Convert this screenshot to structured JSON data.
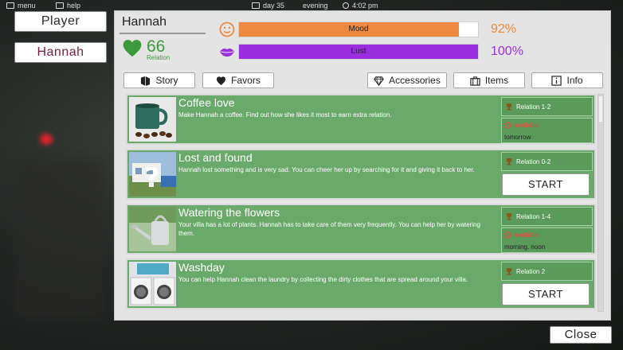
{
  "topbar": {
    "menu": "menu",
    "help": "help",
    "day": "day 35",
    "time_of_day": "evening",
    "clock": "4:02 pm"
  },
  "sidebar": {
    "player": "Player",
    "hannah": "Hannah"
  },
  "character": {
    "name": "Hannah",
    "relation_value": "66",
    "relation_label": "Relation"
  },
  "stats": {
    "mood": {
      "label": "Mood",
      "value_text": "92%",
      "fraction": 0.92,
      "color": "#ee8a3f"
    },
    "lust": {
      "label": "Lust",
      "value_text": "100%",
      "fraction": 1.0,
      "color": "#9b2fe0"
    }
  },
  "tabs": {
    "story": "Story",
    "favors": "Favors",
    "accessories": "Accessories",
    "items": "Items",
    "info": "Info"
  },
  "quests": [
    {
      "title": "Coffee love",
      "description": "Make Hannah a coffee. Find out how she likes it most to earn extra relation.",
      "requirement": "Relation 1-2",
      "available_label": "available:",
      "available_when": "tomorrow",
      "image": "coffee-cup-image"
    },
    {
      "title": "Lost and found",
      "description": "Hannah lost something and is very sad. You can cheer her up by searching for it and giving it back to her.",
      "requirement": "Relation 0-2",
      "button": "START",
      "image": "question-mark-house-image"
    },
    {
      "title": "Watering the flowers",
      "description": "Your villa has a lot of plants. Hannah has to take care of them very frequently. You can help her by watering them.",
      "requirement": "Relation 1-4",
      "available_label": "available:",
      "available_when": "morning, noon",
      "image": "watering-can-image"
    },
    {
      "title": "Washday",
      "description": "You can help Hannah clean the laundry by collecting the dirty clothes that are spread around your villa.",
      "requirement": "Relation 2",
      "button": "START",
      "image": "washing-machine-image"
    }
  ],
  "close": "Close",
  "icons": {
    "relation": "green-heart-icon",
    "mood": "smiley-face-icon",
    "lust": "lips-icon",
    "story": "book-icon",
    "favors": "heart-icon",
    "accessories": "diamond-icon",
    "items": "briefcase-icon",
    "info": "info-icon",
    "requirement": "trophy-icon",
    "available": "clock-icon"
  }
}
